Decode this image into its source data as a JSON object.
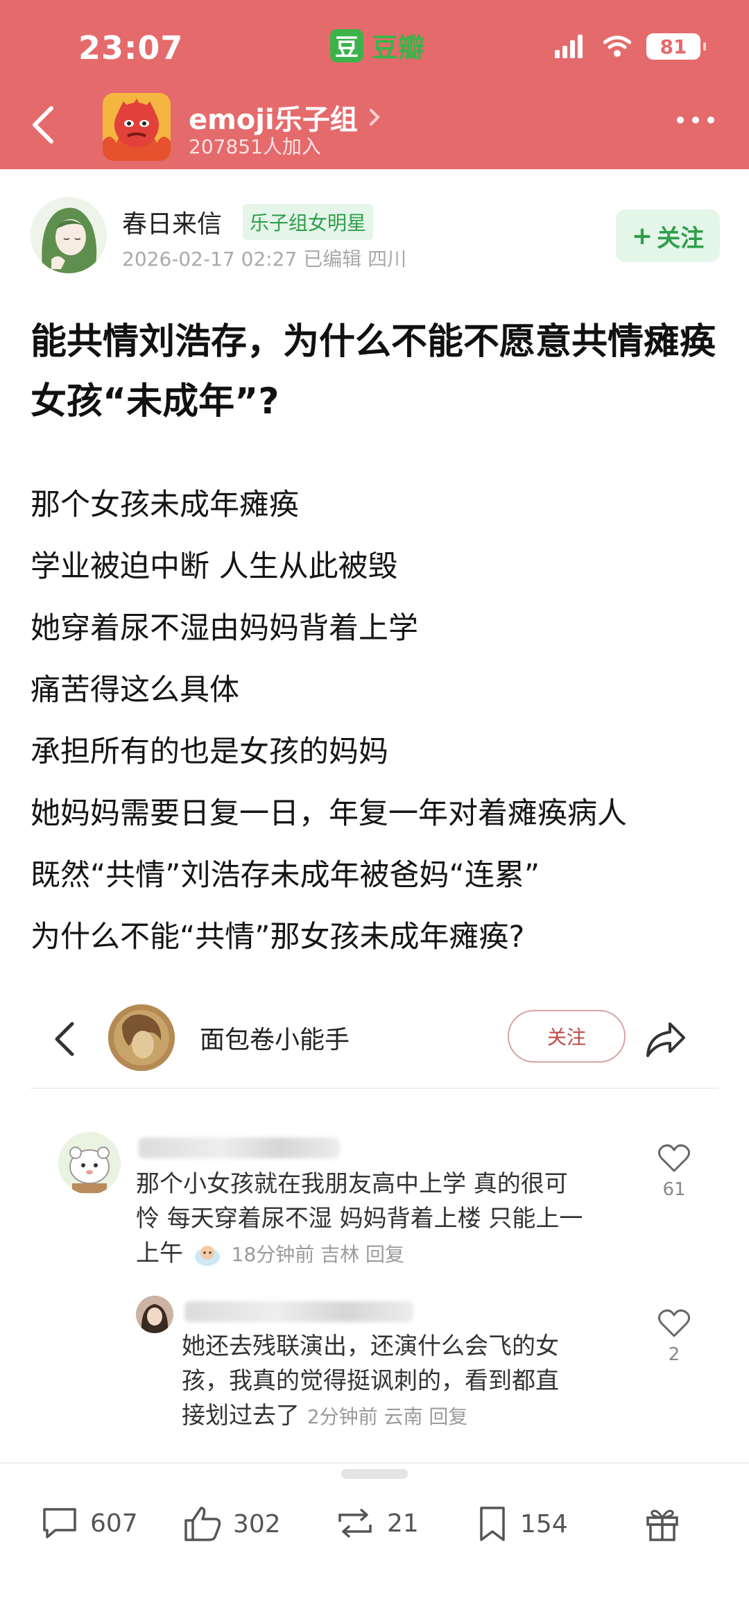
{
  "status_bar": {
    "time": "23:07",
    "app_logo_char": "豆",
    "app_name": "豆瓣",
    "battery": "81",
    "accent": "#e56a6c",
    "app_color": "#3cb34a"
  },
  "group": {
    "title": "emoji乐子组",
    "members": "207851人加入"
  },
  "post": {
    "author": "春日来信",
    "badge": "乐子组女明星",
    "meta": "2026-02-17 02:27  已编辑  四川",
    "follow_label": "关注",
    "follow_plus": "+",
    "title": "能共情刘浩存，为什么不能不愿意共情瘫痪女孩“未成年”?",
    "body": [
      "那个女孩未成年瘫痪",
      "学业被迫中断 人生从此被毁",
      "她穿着尿不湿由妈妈背着上学",
      "痛苦得这么具体",
      "承担所有的也是女孩的妈妈",
      "她妈妈需要日复一日，年复一年对着瘫痪病人",
      "既然“共情”刘浩存未成年被爸妈“连累”",
      "为什么不能“共情”那女孩未成年瘫痪?"
    ]
  },
  "embed": {
    "user_name": "面包卷小能手",
    "follow_label": "关注",
    "comments": [
      {
        "text_lines": [
          "那个小女孩就在我朋友高中上学 真的很可",
          "怜 每天穿着尿不湿 妈妈背着上楼 只能上一",
          "上午"
        ],
        "meta": "18分钟前 吉林  回复",
        "likes": "61"
      },
      {
        "text_lines": [
          "她还去残联演出，还演什么会飞的女",
          "孩，我真的觉得挺讽刺的，看到都直",
          "接划过去了"
        ],
        "meta": "2分钟前 云南  回复",
        "likes": "2"
      }
    ]
  },
  "actions": {
    "comments": "607",
    "likes": "302",
    "reposts": "21",
    "collects": "154"
  }
}
